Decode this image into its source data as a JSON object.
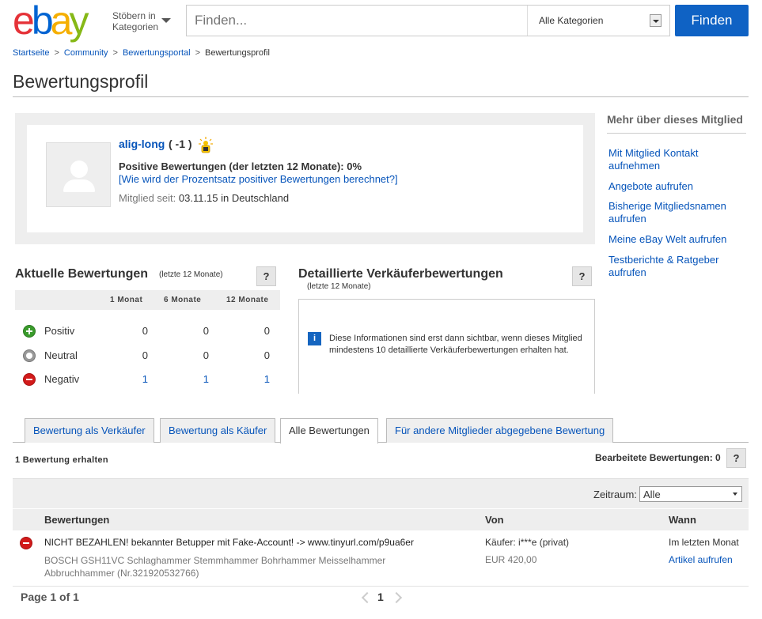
{
  "header": {
    "logo_letters": [
      "e",
      "b",
      "a",
      "y"
    ],
    "logo_colors": [
      "#e53238",
      "#0064d2",
      "#f5af02",
      "#86b817"
    ],
    "browse_label": "Stöbern in Kategorien",
    "search_placeholder": "Finden...",
    "category_value": "Alle Kategorien",
    "find_button": "Finden"
  },
  "breadcrumb": [
    "Startseite",
    "Community",
    "Bewertungsportal",
    "Bewertungsprofil"
  ],
  "breadcrumb_sep": ">",
  "page_title": "Bewertungsprofil",
  "profile": {
    "username": "alig-long",
    "score": "( -1 )",
    "positive_line": "Positive Bewertungen (der letzten 12 Monate): 0%",
    "positive_link": "[Wie wird der Prozentsatz positiver Bewertungen berechnet?]",
    "member_label": "Mitglied seit:",
    "member_value": "03.11.15 in Deutschland"
  },
  "sidebar": {
    "title": "Mehr über dieses Mitglied",
    "links": [
      "Mit Mitglied Kontakt aufnehmen",
      "Angebote aufrufen",
      "Bisherige Mitgliedsnamen aufrufen",
      "Meine eBay Welt aufrufen",
      "Testberichte & Ratgeber aufrufen"
    ]
  },
  "current": {
    "title": "Aktuelle Bewertungen",
    "subtitle": "(letzte 12 Monate)",
    "help": "?",
    "columns": [
      "1 Monat",
      "6 Monate",
      "12 Monate"
    ],
    "rows": [
      {
        "label": "Positiv",
        "values": [
          "0",
          "0",
          "0"
        ]
      },
      {
        "label": "Neutral",
        "values": [
          "0",
          "0",
          "0"
        ]
      },
      {
        "label": "Negativ",
        "values": [
          "1",
          "1",
          "1"
        ]
      }
    ]
  },
  "dsr": {
    "title": "Detaillierte Verkäuferbewertungen",
    "subtitle": "(letzte 12 Monate)",
    "help": "?",
    "info_icon": "i",
    "text": "Diese Informationen sind erst dann sichtbar, wenn dieses Mitglied mindestens 10 detaillierte Verkäuferbewertungen erhalten hat."
  },
  "tabs": [
    {
      "label": "Bewertung als Verkäufer",
      "active": false
    },
    {
      "label": "Bewertung als Käufer",
      "active": false
    },
    {
      "label": "Alle Bewertungen",
      "active": true
    },
    {
      "label": "Für andere Mitglieder abgegebene Bewertung",
      "active": false
    }
  ],
  "received": "1 Bewertung erhalten",
  "edited": "Bearbeitete Bewertungen: 0",
  "edited_help": "?",
  "filter": {
    "label": "Zeitraum:",
    "value": "Alle"
  },
  "table": {
    "headers": [
      "Bewertungen",
      "Von",
      "Wann"
    ],
    "row": {
      "feedback": "NICHT BEZAHLEN! bekannter Betupper mit Fake-Account! -> www.tinyurl.com/p9ua6er",
      "item": "BOSCH GSH11VC Schlaghammer Stemmhammer Bohrhammer Meisselhammer Abbruchhammer (Nr.321920532766)",
      "from": "Käufer: i***e (privat)",
      "price": "EUR 420,00",
      "when": "Im letzten Monat",
      "view_link": "Artikel aufrufen"
    }
  },
  "pagination": {
    "label": "Page 1 of 1",
    "current": "1"
  }
}
